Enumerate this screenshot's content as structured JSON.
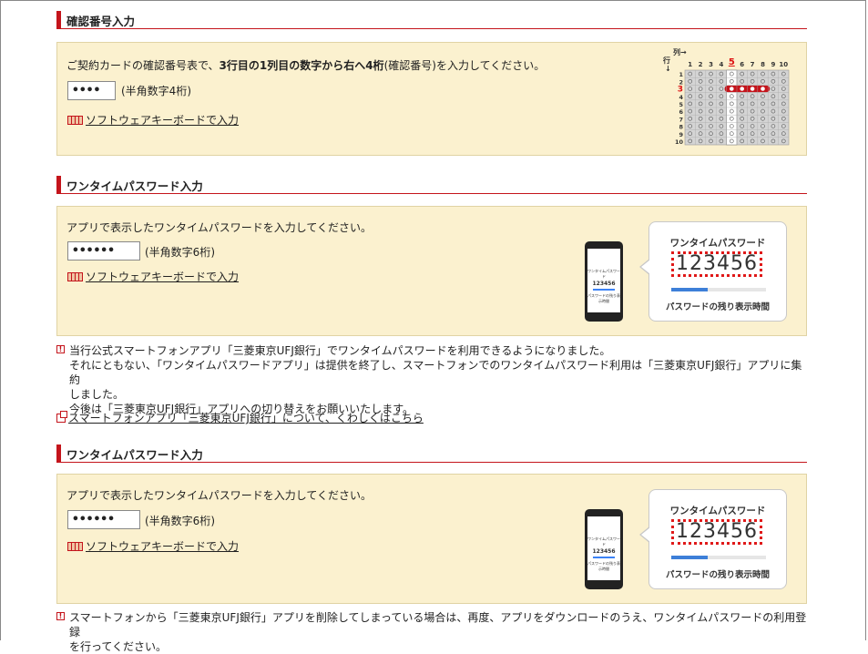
{
  "section1": {
    "heading": "確認番号入力",
    "instruction_pre": "ご契約カードの確認番号表で、",
    "instruction_bold": "3行目の1列目の数字から右へ4桁",
    "instruction_post": "(確認番号)を入力してください。",
    "input_value": "••••",
    "input_hint": "(半角数字4桁)",
    "keyboard_link": "ソフトウェアキーボードで入力",
    "grid": {
      "col_label": "列→",
      "row_label": "行",
      "row_arrow": "↓",
      "columns": [
        "1",
        "2",
        "3",
        "4",
        "5",
        "6",
        "7",
        "8",
        "9",
        "10"
      ],
      "rows": [
        "1",
        "2",
        "3",
        "4",
        "5",
        "6",
        "7",
        "8",
        "9",
        "10"
      ],
      "highlight_row_label": "3",
      "highlight_col_label": "5"
    }
  },
  "section2": {
    "heading": "ワンタイムパスワード入力",
    "instruction": "アプリで表示したワンタイムパスワードを入力してください。",
    "input_value": "••••••",
    "input_hint": "(半角数字6桁)",
    "keyboard_link": "ソフトウェアキーボードで入力",
    "bubble": {
      "title": "ワンタイムパスワード",
      "number": "123456",
      "footer": "パスワードの残り表示時間",
      "remaining_fraction": 0.38
    },
    "phone": {
      "title": "ワンタイムパスワード",
      "number": "123456",
      "footer": "パスワードの残り表示時間"
    }
  },
  "notice": {
    "lines": [
      "当行公式スマートフォンアプリ「三菱東京UFJ銀行」でワンタイムパスワードを利用できるようになりました。",
      "それにともない、「ワンタイムパスワードアプリ」は提供を終了し、スマートフォンでのワンタイムパスワード利用は「三菱東京UFJ銀行」アプリに集約",
      "しました。",
      "今後は「三菱東京UFJ銀行」アプリへの切り替えをお願いいたします。"
    ],
    "link": "スマートフォンアプリ「三菱東京UFJ銀行」について、くわしくはこちら"
  },
  "section3": {
    "heading": "ワンタイムパスワード入力",
    "instruction": "アプリで表示したワンタイムパスワードを入力してください。",
    "input_value": "••••••",
    "input_hint": "(半角数字6桁)",
    "keyboard_link": "ソフトウェアキーボードで入力",
    "bubble": {
      "title": "ワンタイムパスワード",
      "number": "123456",
      "footer": "パスワードの残り表示時間",
      "remaining_fraction": 0.38
    },
    "phone": {
      "title": "ワンタイムパスワード",
      "number": "123456",
      "footer": "パスワードの残り表示時間"
    }
  },
  "bottom_notice": {
    "lines": [
      "スマートフォンから「三菱東京UFJ銀行」アプリを削除してしまっている場合は、再度、アプリをダウンロードのうえ、ワンタイムパスワードの利用登録",
      "を行ってください。"
    ]
  }
}
